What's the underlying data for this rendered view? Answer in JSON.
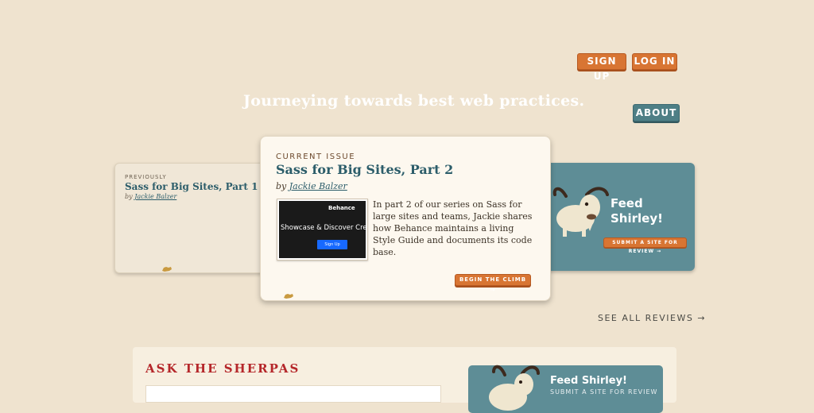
{
  "header": {
    "signup_label": "SIGN UP",
    "login_label": "LOG IN",
    "about_label": "ABOUT",
    "tagline": "Journeying towards best web practices."
  },
  "previous": {
    "eyebrow": "PREVIOUSLY",
    "title": "Sass for Big Sites, Part 1",
    "by": "by",
    "author": "Jackie Balzer"
  },
  "current": {
    "eyebrow": "CURRENT ISSUE",
    "title": "Sass for Big Sites, Part 2",
    "by": "by",
    "author": "Jackie Balzer",
    "thumb_brand": "Behance",
    "thumb_headline": "Showcase & Discover Crea",
    "thumb_button": "Sign Up",
    "excerpt": "In part 2 of our series on Sass for large sites and teams, Jackie shares how Behance maintains a living Style Guide and documents its code base.",
    "cta": "BEGIN THE CLIMB →"
  },
  "feed": {
    "title_line1": "Feed",
    "title_line2": "Shirley!",
    "submit": "SUBMIT A SITE FOR REVIEW →"
  },
  "see_all": "SEE ALL REVIEWS →",
  "ask": {
    "heading": "ASK THE SHERPAS",
    "feed_title": "Feed Shirley!",
    "feed_sub": "SUBMIT A SITE FOR REVIEW"
  },
  "colors": {
    "background": "#efe3cf",
    "accent_orange": "#d87533",
    "teal": "#5e8d96",
    "title_teal": "#2c5d6a",
    "heading_red": "#b5272a"
  }
}
